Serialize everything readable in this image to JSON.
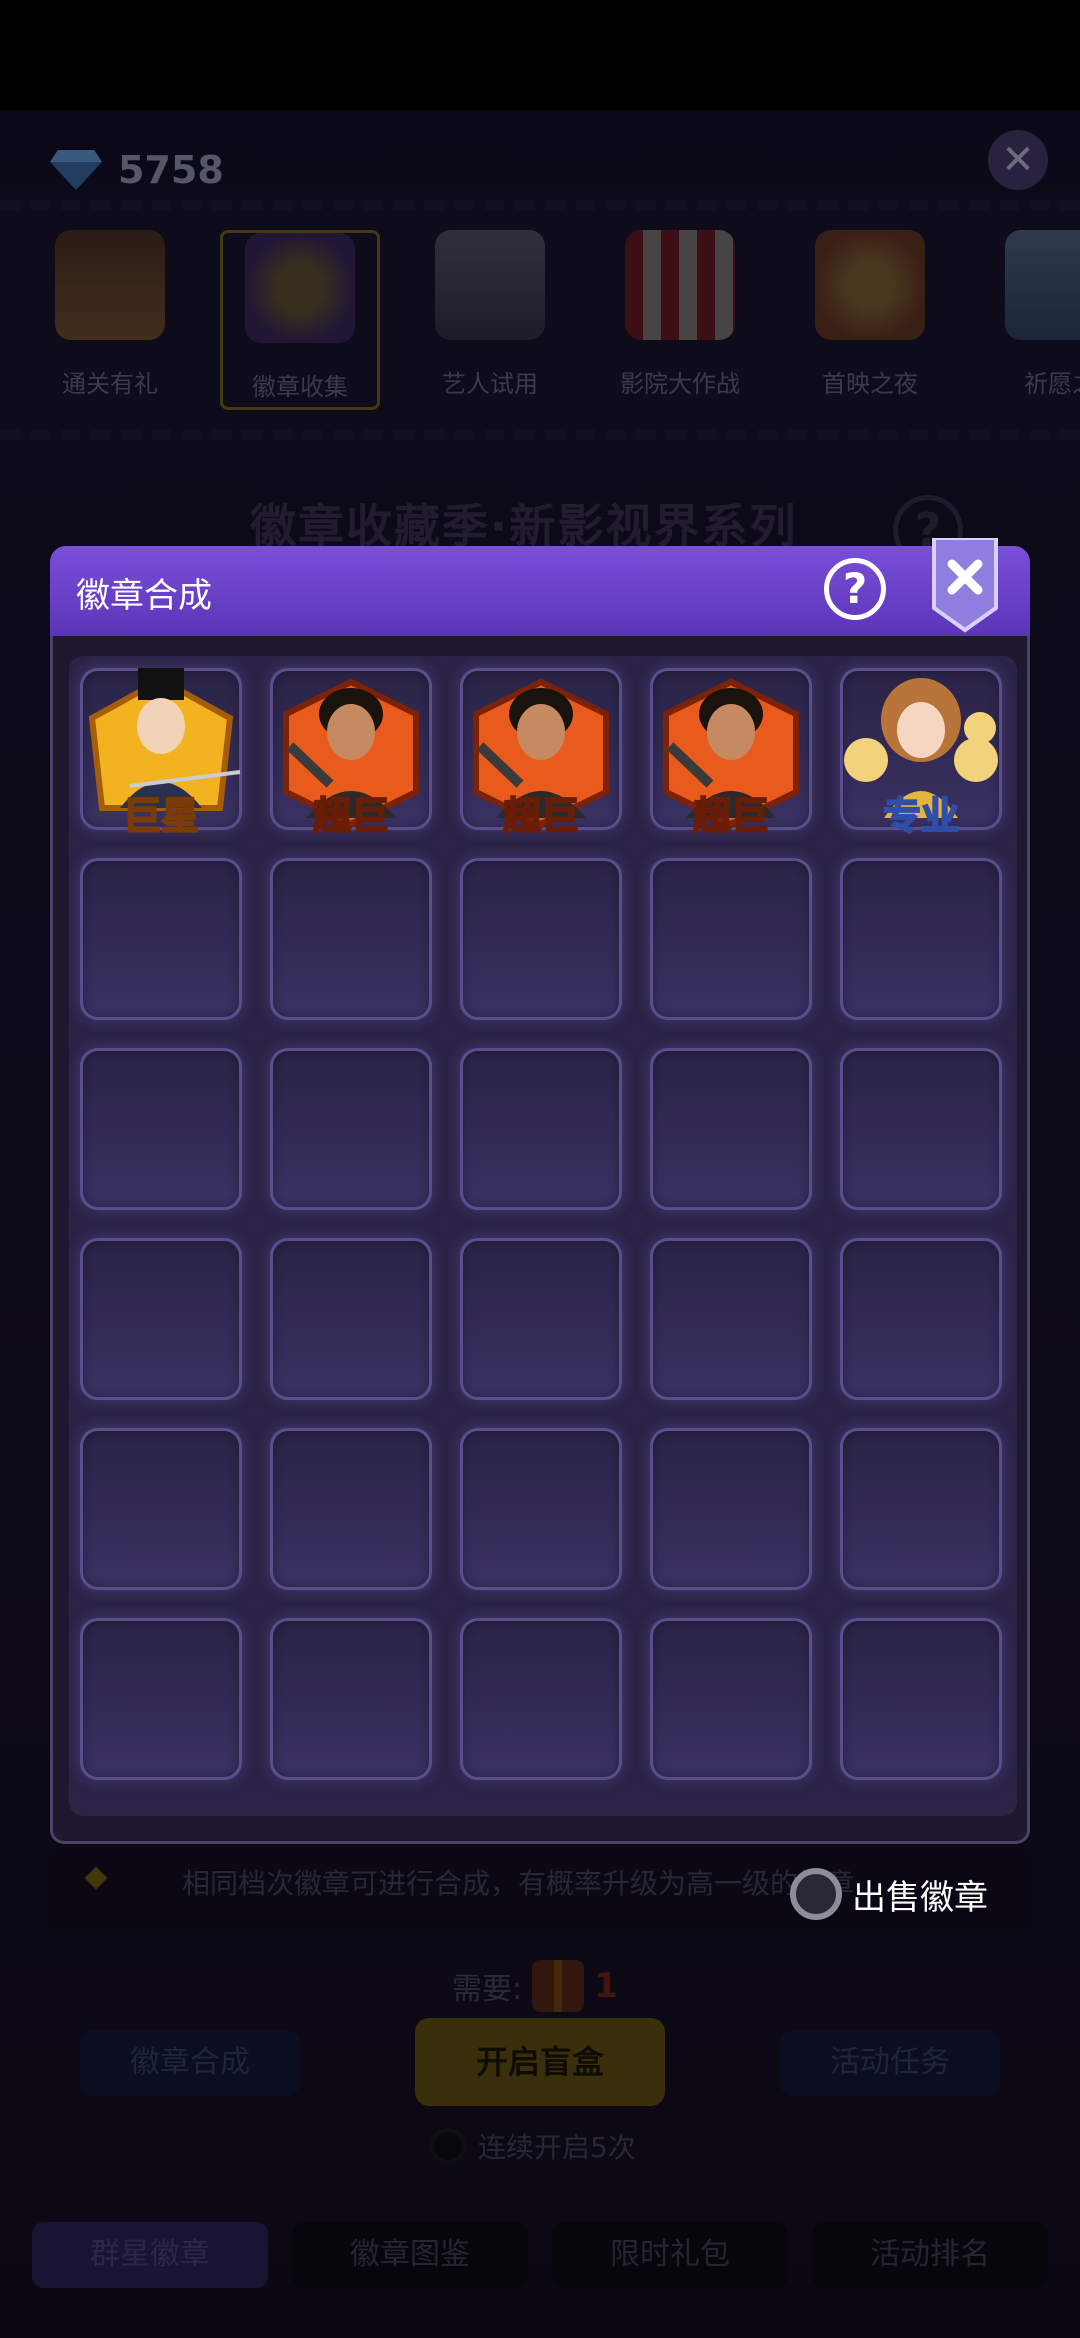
{
  "currency": {
    "value": "5758",
    "icon": "diamond-icon"
  },
  "categories": [
    {
      "label": "通关有礼",
      "icon": "ship-icon",
      "active": false
    },
    {
      "label": "徽章收集",
      "icon": "badge-icon",
      "active": true
    },
    {
      "label": "艺人试用",
      "icon": "chess-knight-icon",
      "active": false
    },
    {
      "label": "影院大作战",
      "icon": "popcorn-icon",
      "active": false
    },
    {
      "label": "首映之夜",
      "icon": "star-award-icon",
      "active": false
    },
    {
      "label": "祈愿之",
      "icon": "fountain-icon",
      "active": false
    }
  ],
  "season_title": "徽章收藏季·新影视界系列",
  "modal": {
    "title": "徽章合成",
    "badges": [
      {
        "label": "巨星",
        "tier": "gold",
        "character": "scholar"
      },
      {
        "label": "超巨",
        "tier": "fire",
        "character": "commando"
      },
      {
        "label": "超巨",
        "tier": "fire",
        "character": "commando"
      },
      {
        "label": "超巨",
        "tier": "fire",
        "character": "commando"
      },
      {
        "label": "专业",
        "tier": "blue",
        "character": "lady"
      }
    ]
  },
  "hint": "相同档次徽章可进行合成，有概率升级为高一级的徽章",
  "sell_label": "出售徽章",
  "need": {
    "label": "需要:",
    "count": "1"
  },
  "actions": {
    "synth": "徽章合成",
    "open": "开启盲盒",
    "task": "活动任务"
  },
  "continuous_label": "连续开启5次",
  "bottom_tabs": [
    "群星徽章",
    "徽章图鉴",
    "限时礼包",
    "活动排名"
  ],
  "colors": {
    "header": "#6a42c8",
    "accent_gold": "#ffd86a",
    "slot_border": "#5a4f8c"
  }
}
